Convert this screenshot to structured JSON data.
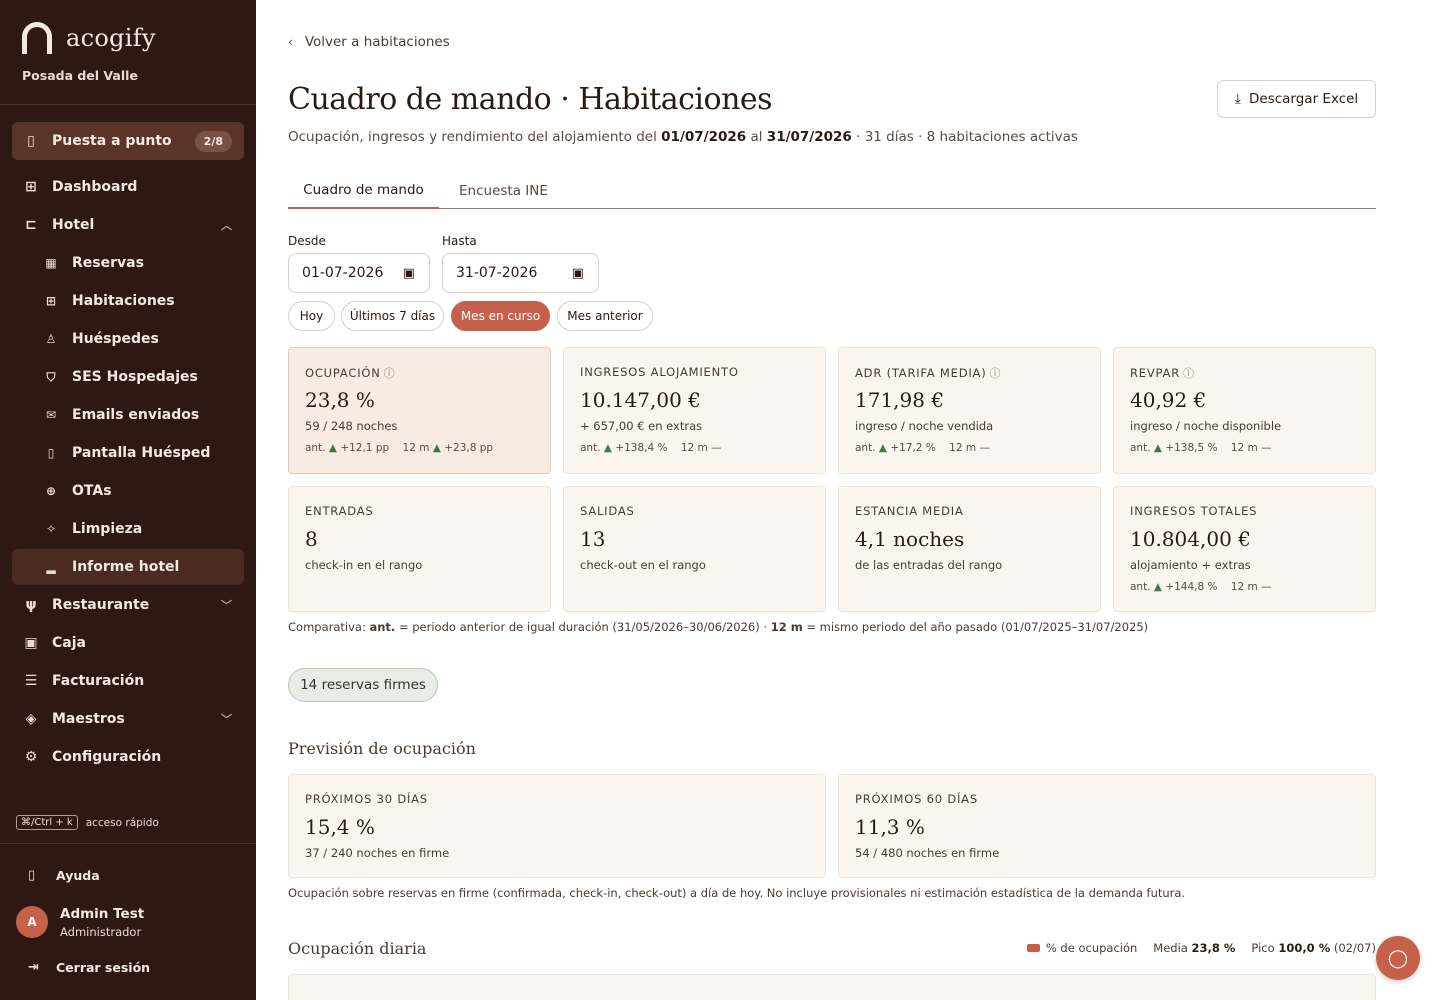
{
  "brand": {
    "name": "acogify",
    "property": "Posada del Valle"
  },
  "sidebar": {
    "setup": {
      "label": "Puesta a punto",
      "badge": "2/8"
    },
    "items": [
      {
        "label": "Dashboard",
        "icon": "grid-icon"
      },
      {
        "label": "Hotel",
        "icon": "bed-icon"
      },
      {
        "label": "Reservas",
        "icon": "calendar-icon"
      },
      {
        "label": "Habitaciones",
        "icon": "grid-icon"
      },
      {
        "label": "Huéspedes",
        "icon": "user-icon"
      },
      {
        "label": "SES Hospedajes",
        "icon": "shield-icon"
      },
      {
        "label": "Emails enviados",
        "icon": "mail-icon"
      },
      {
        "label": "Pantalla Huésped",
        "icon": "clipboard-icon"
      },
      {
        "label": "OTAs",
        "icon": "globe-icon"
      },
      {
        "label": "Limpieza",
        "icon": "sparkle-icon"
      },
      {
        "label": "Informe hotel",
        "icon": "bar-chart-icon"
      },
      {
        "label": "Restaurante",
        "icon": "utensils-icon"
      },
      {
        "label": "Caja",
        "icon": "wallet-icon"
      },
      {
        "label": "Facturación",
        "icon": "receipt-icon"
      },
      {
        "label": "Maestros",
        "icon": "layers-icon"
      },
      {
        "label": "Configuración",
        "icon": "gear-icon"
      }
    ],
    "shortcut_key": "⌘/Ctrl + k",
    "shortcut_label": "acceso rápido",
    "help": "Ayuda",
    "user": {
      "initial": "A",
      "name": "Admin Test",
      "role": "Administrador"
    },
    "logout": "Cerrar sesión"
  },
  "header": {
    "back": "Volver a habitaciones",
    "title": "Cuadro de mando · Habitaciones",
    "subtitle_pre": "Ocupación, ingresos y rendimiento del alojamiento del",
    "date_from": "01/07/2026",
    "subtitle_mid": "al",
    "date_to": "31/07/2026",
    "subtitle_post": "· 31 días · 8 habitaciones activas",
    "download": "Descargar Excel"
  },
  "tabs": [
    "Cuadro de mando",
    "Encuesta INE"
  ],
  "filters": {
    "from_label": "Desde",
    "from_value": "01-07-2026",
    "to_label": "Hasta",
    "to_value": "31-07-2026",
    "quick": [
      "Hoy",
      "Últimos 7 días",
      "Mes en curso",
      "Mes anterior"
    ],
    "quick_active": "Mes en curso"
  },
  "kpis": [
    {
      "label": "OCUPACIÓN",
      "value": "23,8 %",
      "sub": "59 / 248 noches",
      "cmp_ant": "+12,1 pp",
      "cmp_12m": "+23,8 pp"
    },
    {
      "label": "INGRESOS ALOJAMIENTO",
      "value": "10.147,00 €",
      "sub": "+ 657,00 € en extras",
      "cmp_ant": "+138,4 %",
      "cmp_12m": "—"
    },
    {
      "label": "ADR (TARIFA MEDIA)",
      "value": "171,98 €",
      "sub": "ingreso / noche vendida",
      "cmp_ant": "+17,2 %",
      "cmp_12m": "—"
    },
    {
      "label": "REVPAR",
      "value": "40,92 €",
      "sub": "ingreso / noche disponible",
      "cmp_ant": "+138,5 %",
      "cmp_12m": "—"
    },
    {
      "label": "ENTRADAS",
      "value": "8",
      "sub": "check-in en el rango"
    },
    {
      "label": "SALIDAS",
      "value": "13",
      "sub": "check-out en el rango"
    },
    {
      "label": "ESTANCIA MEDIA",
      "value": "4,1 noches",
      "sub": "de las entradas del rango"
    },
    {
      "label": "INGRESOS TOTALES",
      "value": "10.804,00 €",
      "sub": "alojamiento + extras",
      "cmp_ant": "+144,8 %",
      "cmp_12m": "—"
    }
  ],
  "cmp_labels": {
    "ant": "ant.",
    "m12": "12 m"
  },
  "legend_note": {
    "pre": "Comparativa:",
    "ant": "ant.",
    "ant_desc": "= periodo anterior de igual duración (31/05/2026–30/06/2026) ·",
    "m12": "12 m",
    "m12_desc": "= mismo periodo del año pasado (01/07/2025–31/07/2025)"
  },
  "firm_pill": "14 reservas firmes",
  "forecast": {
    "title": "Previsión de ocupación",
    "cards": [
      {
        "label": "PRÓXIMOS 30 DÍAS",
        "value": "15,4 %",
        "sub": "37 / 240 noches en firme"
      },
      {
        "label": "PRÓXIMOS 60 DÍAS",
        "value": "11,3 %",
        "sub": "54 / 480 noches en firme"
      }
    ],
    "note": "Ocupación sobre reservas en firme (confirmada, check-in, check-out) a día de hoy. No incluye provisionales ni estimación estadística de la demanda futura."
  },
  "daily": {
    "title": "Ocupación diaria",
    "legend": "% de ocupación",
    "media_label": "Media",
    "media_value": "23,8 %",
    "pico_label": "Pico",
    "pico_value": "100,0 %",
    "pico_date": "(02/07)"
  },
  "colors": {
    "accent": "#c6604a",
    "sidebar": "#2e1912",
    "card": "#faf5ee",
    "positive": "#3d7a4a"
  }
}
